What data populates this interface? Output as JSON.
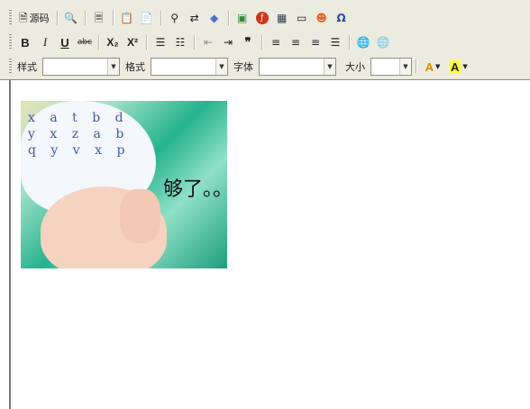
{
  "toolbar": {
    "row1": {
      "source_label": "源码",
      "icons": [
        "document-icon",
        "preview-icon",
        "template-icon",
        "paste-icon",
        "paste-word-icon",
        "find-icon",
        "replace-icon",
        "eraser-icon",
        "image-icon",
        "flash-icon",
        "table-icon",
        "horizontal-rule-icon",
        "smiley-icon",
        "omega-icon"
      ]
    },
    "row2": {
      "bold": "B",
      "italic": "I",
      "underline": "U",
      "strike": "abc",
      "subscript": "X₂",
      "superscript": "X²",
      "blockquote": "❞"
    },
    "row3": {
      "style_label": "样式",
      "format_label": "格式",
      "font_label": "字体",
      "size_label": "大小",
      "style_value": "",
      "format_value": "",
      "font_value": "",
      "size_value": "",
      "text_color_letter": "A",
      "bg_color_letter": "A",
      "text_color": "#d98c00",
      "bg_color": "#ffff40"
    }
  },
  "content": {
    "image_caption": "够了。。"
  },
  "colors": {
    "toolbar_bg": "#ecebe0",
    "border": "#8b8b82"
  }
}
